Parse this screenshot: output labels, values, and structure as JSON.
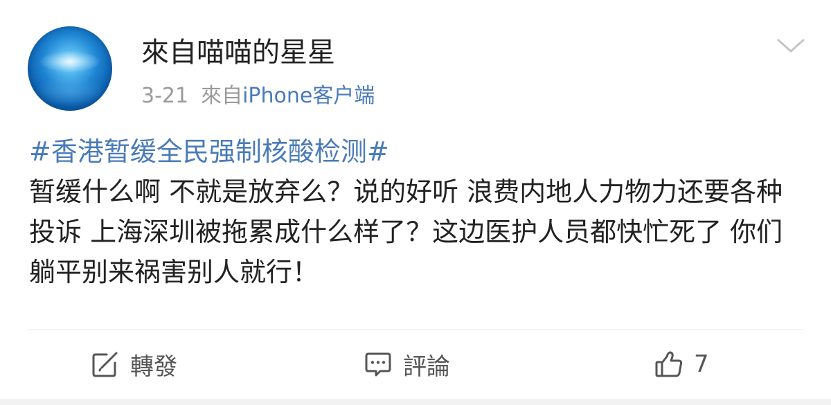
{
  "post": {
    "author": "來自喵喵的星星",
    "date": "3-21",
    "source_prefix": "來自",
    "source_client": "iPhone客户端",
    "topic": "#香港暂缓全民强制核酸检测#",
    "text": "暂缓什么啊 不就是放弃么？说的好听 浪费内地人力物力还要各种投诉 上海深圳被拖累成什么样了？这边医护人员都快忙死了 你们躺平别来祸害别人就行！"
  },
  "actions": {
    "repost_label": "轉發",
    "comment_label": "評論",
    "like_count": "7"
  },
  "icons": {
    "menu": "chevron-down-icon",
    "repost": "repost-icon",
    "comment": "comment-icon",
    "like": "thumbs-up-icon"
  },
  "colors": {
    "link": "#4a7bb8",
    "text": "#222222",
    "meta": "#9a9a9a",
    "action_label": "#555555"
  }
}
